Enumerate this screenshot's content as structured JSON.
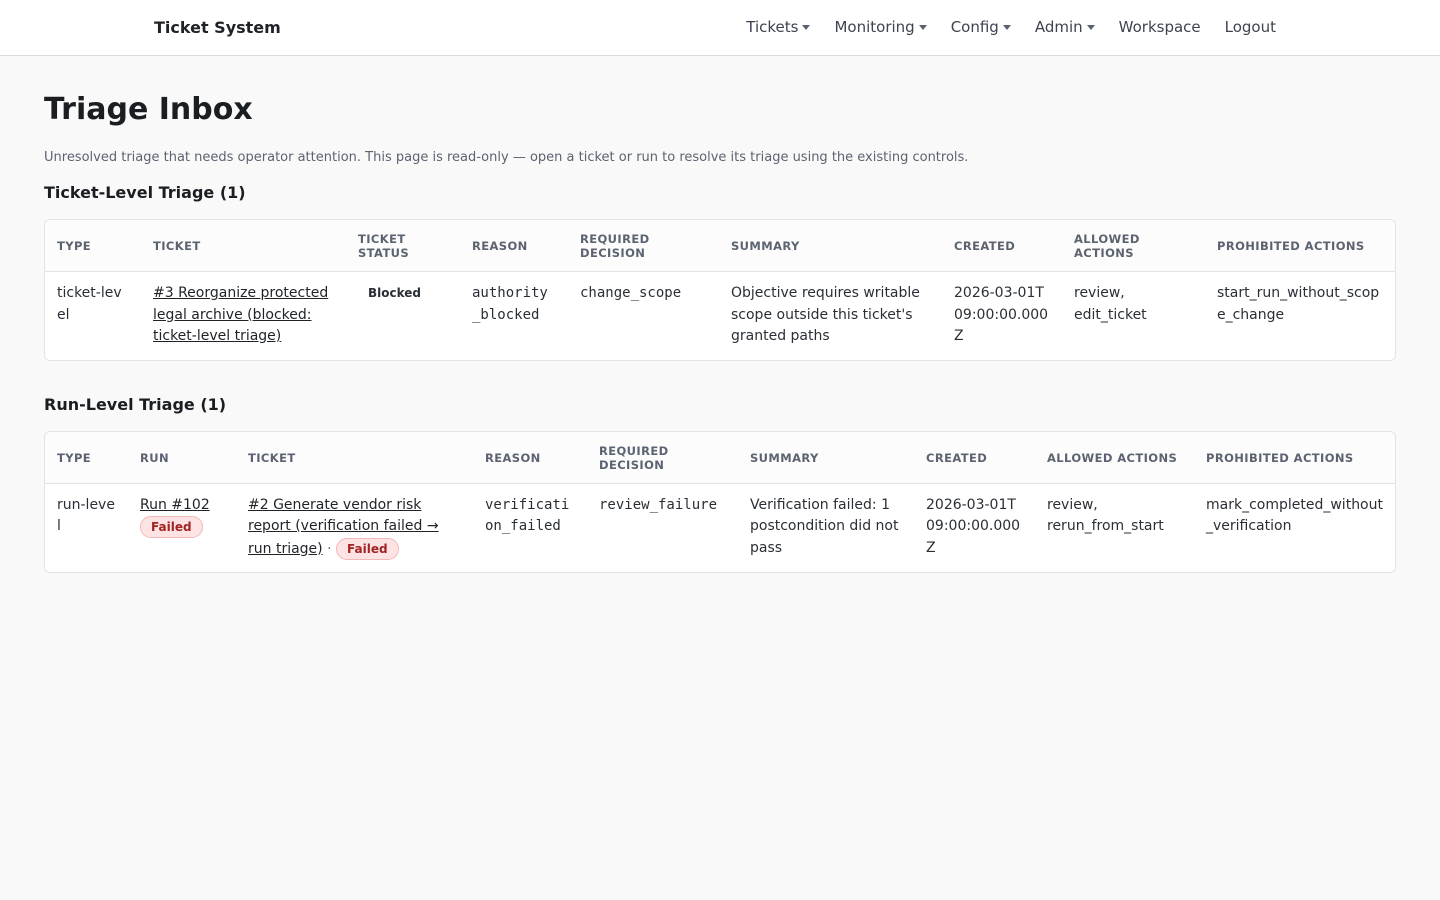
{
  "app": {
    "brand": "Ticket System",
    "nav": [
      {
        "label": "Tickets",
        "dropdown": true
      },
      {
        "label": "Monitoring",
        "dropdown": true
      },
      {
        "label": "Config",
        "dropdown": true
      },
      {
        "label": "Admin",
        "dropdown": true
      },
      {
        "label": "Workspace",
        "dropdown": false
      },
      {
        "label": "Logout",
        "dropdown": false
      }
    ]
  },
  "page": {
    "title": "Triage Inbox",
    "intro": "Unresolved triage that needs operator attention. This page is read-only — open a ticket or run to resolve its triage using the existing controls."
  },
  "ticket_section": {
    "title": "Ticket-Level Triage (1)",
    "headers": [
      "TYPE",
      "TICKET",
      "TICKET STATUS",
      "REASON",
      "REQUIRED DECISION",
      "SUMMARY",
      "CREATED",
      "ALLOWED ACTIONS",
      "PROHIBITED ACTIONS"
    ],
    "rows": [
      {
        "type": "ticket-level",
        "ticket": "#3 Reorganize protected legal archive (blocked: ticket-level triage)",
        "status": "Blocked",
        "reason": "authority_blocked",
        "decision": "change_scope",
        "summary": "Objective requires writable scope outside this ticket's granted paths",
        "created": "2026-03-01T09:00:00.000Z",
        "allowed": "review, edit_ticket",
        "prohibited": "start_run_without_scope_change"
      }
    ]
  },
  "run_section": {
    "title": "Run-Level Triage (1)",
    "headers": [
      "TYPE",
      "RUN",
      "TICKET",
      "REASON",
      "REQUIRED DECISION",
      "SUMMARY",
      "CREATED",
      "ALLOWED ACTIONS",
      "PROHIBITED ACTIONS"
    ],
    "rows": [
      {
        "type": "run-level",
        "run": "Run #102",
        "run_status": "Failed",
        "ticket": "#2 Generate vendor risk report (verification failed → run triage)",
        "separator": "·",
        "ticket_status": "Failed",
        "reason": "verification_failed",
        "decision": "review_failure",
        "summary": "Verification failed: 1 postcondition did not pass",
        "created": "2026-03-01T09:00:00.000Z",
        "allowed": "review, rerun_from_start",
        "prohibited": "mark_completed_without_verification"
      }
    ]
  },
  "colors": {
    "failed_badge_bg": "#fde3e3",
    "failed_badge_text": "#a12424"
  }
}
